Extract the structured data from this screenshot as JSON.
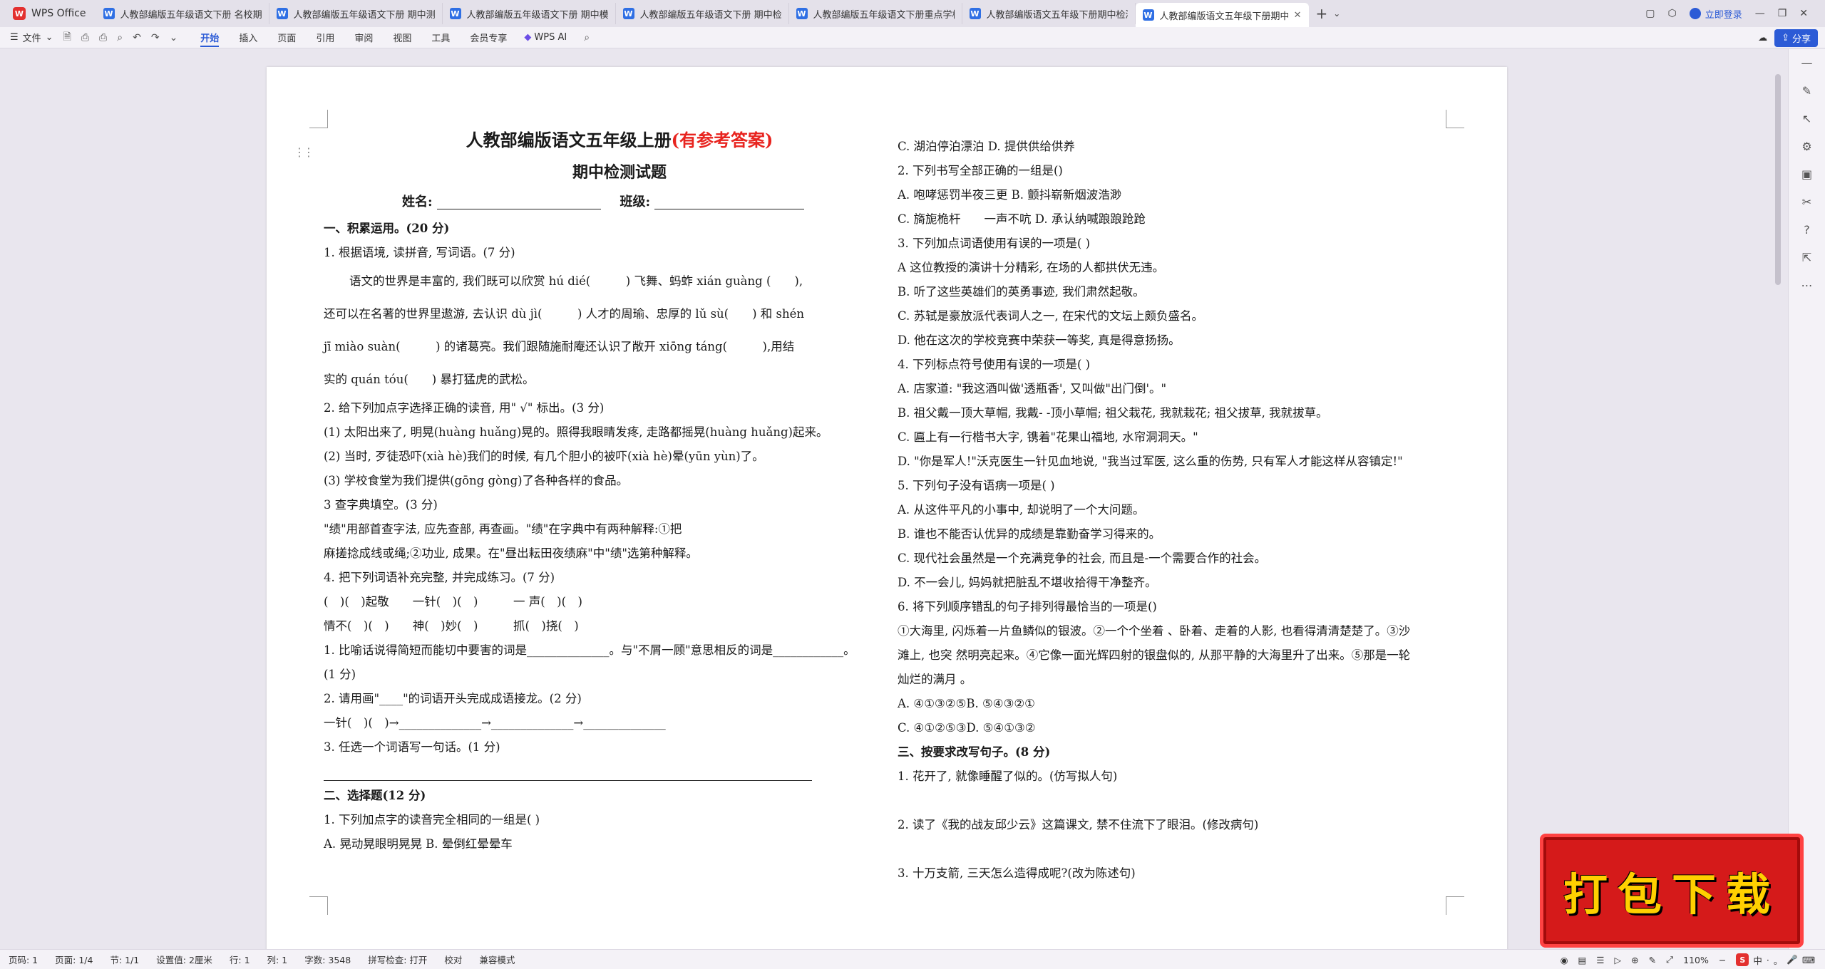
{
  "tabbar": {
    "app_label": "WPS Office",
    "tabs": [
      {
        "title": "人教部编版五年级语文下册 名校期中"
      },
      {
        "title": "人教部编版五年级语文下册 期中测评"
      },
      {
        "title": "人教部编版五年级语文下册 期中模拟"
      },
      {
        "title": "人教部编版五年级语文下册 期中检测"
      },
      {
        "title": "人教部编版五年级语文下册重点学校期"
      },
      {
        "title": "人教部编版语文五年级下册期中检测"
      },
      {
        "title": "人教部编版语文五年级下册期中"
      }
    ],
    "login_label": "立即登录"
  },
  "ribbon": {
    "file_label": "文件",
    "tabs": [
      "开始",
      "插入",
      "页面",
      "引用",
      "审阅",
      "视图",
      "工具",
      "会员专享"
    ],
    "wps_ai_label": "WPS AI",
    "share_label": "分享"
  },
  "document": {
    "title_main": "人教部编版语文五年级上册",
    "title_red": "(有参考答案)",
    "title_sub": "期中检测试题",
    "name_label": "姓名:",
    "class_label": "班级:",
    "left_lines": [
      {
        "t": "一、积累运用。(20 分)",
        "bold": true
      },
      {
        "t": "1. 根据语境, 读拼音, 写词语。(7 分)"
      },
      {
        "t": "语文的世界是丰富的, 我们既可以欣赏 hú dié(　　　) 飞舞、蚂蚱 xián guàng (　　),",
        "tall": true,
        "indent": true
      },
      {
        "t": "还可以在名著的世界里遨游, 去认识 dù jì(　　　) 人才的周瑜、忠厚的 lǔ sù(　　) 和 shén",
        "tall": true
      },
      {
        "t": "jī miào suàn(　　　) 的诸葛亮。我们跟随施耐庵还认识了敞开 xiōng táng(　　　),用结",
        "tall": true
      },
      {
        "t": "实的 quán tóu(　　) 暴打猛虎的武松。",
        "tall": true
      },
      {
        "t": "2. 给下列加点字选择正确的读音, 用\" √\" 标出。(3 分)"
      },
      {
        "t": "(1) 太阳出来了, 明晃(huàng huǎng)晃的。照得我眼睛发疼, 走路都摇晃(huàng huǎng)起来。",
        "tall": false
      },
      {
        "t": "(2) 当时, 歹徒恐吓(xià hè)我们的时候, 有几个胆小的被吓(xià hè)晕(yūn yùn)了。"
      },
      {
        "t": "(3) 学校食堂为我们提供(gōng gòng)了各种各样的食品。"
      },
      {
        "t": "3 查字典填空。(3 分)"
      },
      {
        "t": "\"绩\"用部首查字法, 应先查部, 再查画。\"绩\"在字典中有两种解释:①把"
      },
      {
        "t": "麻搓捻成线或绳;②功业, 成果。在\"昼出耘田夜绩麻\"中\"绩\"选第种解释。"
      },
      {
        "t": "4. 把下列词语补充完整, 并完成练习。(7 分)"
      },
      {
        "t": "(　)(　)起敬　　一针(　)(　)　　　一 声(　)(　)"
      },
      {
        "t": "情不(　)(　)　　神(　)妙(　)　　　抓(　)挠(　)"
      },
      {
        "t": "1. 比喻话说得简短而能切中要害的词是______________。与\"不屑一顾\"意思相反的词是____________。"
      },
      {
        "t": "(1 分)"
      },
      {
        "t": "2. 请用画\"____\"的词语开头完成成语接龙。(2 分)"
      },
      {
        "t": "一针(　)(　)→______________→______________→______________"
      },
      {
        "t": "3. 任选一个词语写一句话。(1 分)"
      },
      {
        "t": "",
        "rule": true
      },
      {
        "t": "二、选择题(12 分)",
        "bold": true
      },
      {
        "t": "1. 下列加点字的读音完全相同的一组是( )"
      },
      {
        "t": "A. 晃动晃眼明晃晃 B. 晕倒红晕晕车"
      }
    ],
    "right_lines": [
      {
        "t": "C. 湖泊停泊漂泊 D. 提供供给供养"
      },
      {
        "t": "2. 下列书写全部正确的一组是()"
      },
      {
        "t": "A. 咆哮惩罚半夜三更 B. 颤抖崭新烟波浩渺"
      },
      {
        "t": "C. 旖旎桅杆　　一声不吭 D. 承认纳喊踉踉跄跄"
      },
      {
        "t": "3. 下列加点词语使用有误的一项是( )"
      },
      {
        "t": "A 这位教授的演讲十分精彩, 在场的人都拱伏无违。"
      },
      {
        "t": "B. 听了这些英雄们的英勇事迹, 我们肃然起敬。"
      },
      {
        "t": "C. 苏轼是豪放派代表词人之一, 在宋代的文坛上颇负盛名。"
      },
      {
        "t": "D. 他在这次的学校竞赛中荣获一等奖, 真是得意扬扬。"
      },
      {
        "t": "4. 下列标点符号使用有误的一项是( )"
      },
      {
        "t": "A. 店家道: \"我这酒叫做'透瓶香', 又叫做\"出门倒'。\""
      },
      {
        "t": "B. 祖父戴一顶大草帽, 我戴- -顶小草帽; 祖父栽花, 我就栽花; 祖父拔草, 我就拔草。"
      },
      {
        "t": "C. 匾上有一行楷书大字, 镌着\"花果山福地, 水帘洞洞天。\""
      },
      {
        "t": "D. \"你是军人!\"沃克医生一针见血地说, \"我当过军医, 这么重的伤势, 只有军人才能这样从容镇定!\""
      },
      {
        "t": "5. 下列句子没有语病一项是( )"
      },
      {
        "t": "A. 从这件平凡的小事中, 却说明了一个大问题。"
      },
      {
        "t": "B. 谁也不能否认优异的成绩是靠勤奋学习得来的。"
      },
      {
        "t": "C. 现代社会虽然是一个充满竞争的社会, 而且是-一个需要合作的社会。"
      },
      {
        "t": "D. 不一会儿, 妈妈就把脏乱不堪收拾得干净整齐。"
      },
      {
        "t": "6. 将下列顺序错乱的句子排列得最恰当的一项是()"
      },
      {
        "t": "①大海里, 闪烁着一片鱼鳞似的银波。②一个个坐着 、卧着、走着的人影, 也看得清清楚楚了。③沙"
      },
      {
        "t": "滩上, 也突 然明亮起来。④它像一面光辉四射的银盘似的, 从那平静的大海里升了出来。⑤那是一轮"
      },
      {
        "t": "灿烂的满月 。"
      },
      {
        "t": "A. ④①③②⑤B. ⑤④③②①"
      },
      {
        "t": "C. ④①②⑤③D. ⑤④①③②"
      },
      {
        "t": "三、按要求改写句子。(8 分)",
        "bold": true
      },
      {
        "t": "1. 花开了, 就像睡醒了似的。(仿写拟人句)"
      },
      {
        "t": ""
      },
      {
        "t": "2. 读了《我的战友邱少云》这篇课文, 禁不住流下了眼泪。(修改病句)"
      },
      {
        "t": ""
      },
      {
        "t": "3. 十万支箭, 三天怎么造得成呢?(改为陈述句)"
      }
    ]
  },
  "statusbar": {
    "items": [
      "页码: 1",
      "页面: 1/4",
      "节: 1/1",
      "设置值: 2厘米",
      "行: 1",
      "列: 1",
      "字数: 3548",
      "拼写检查: 打开",
      "校对",
      "兼容模式"
    ],
    "zoom": "110%",
    "ime": [
      "中",
      "·",
      "。"
    ]
  },
  "promo": {
    "text": "打包下载"
  }
}
